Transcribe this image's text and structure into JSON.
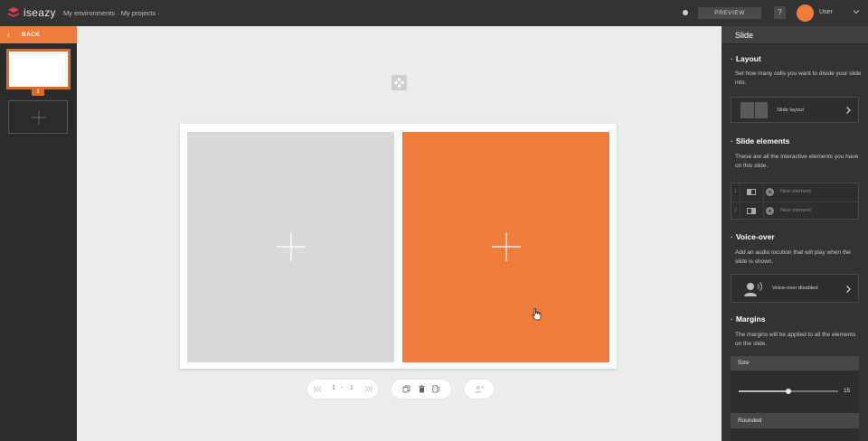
{
  "app": {
    "logo_text": "iseazy",
    "brand_color": "#ee7d3c"
  },
  "header": {
    "breadcrumb": "My environments · My projects ·",
    "preview_label": "PREVIEW",
    "help_label": "?",
    "user_name": "User"
  },
  "left_panel": {
    "back_label": "BACK",
    "slides": [
      {
        "number": "1"
      }
    ]
  },
  "toolbar": {
    "page_current": "1",
    "page_sep": "-",
    "page_total": "1"
  },
  "right_panel": {
    "title": "Slide",
    "layout": {
      "title": "Layout",
      "desc": "Set how many cells you want to divide your slide into.",
      "card_label": "Slide layout"
    },
    "elements": {
      "title": "Slide elements",
      "desc": "These are all the interactive elements you have on this slide.",
      "items": [
        {
          "num": "1",
          "label": "New element"
        },
        {
          "num": "2",
          "label": "New element"
        }
      ]
    },
    "voice": {
      "title": "Voice-over",
      "desc": "Add an audio locution that will play when the slide is shown.",
      "card_label": "Voice-over disabled"
    },
    "margins": {
      "title": "Margins",
      "desc": "The margins will be applied to all the elements on the slide.",
      "size_label": "Size",
      "size_value": "15",
      "size_fraction": 0.5,
      "rounded_label": "Rounded"
    }
  }
}
